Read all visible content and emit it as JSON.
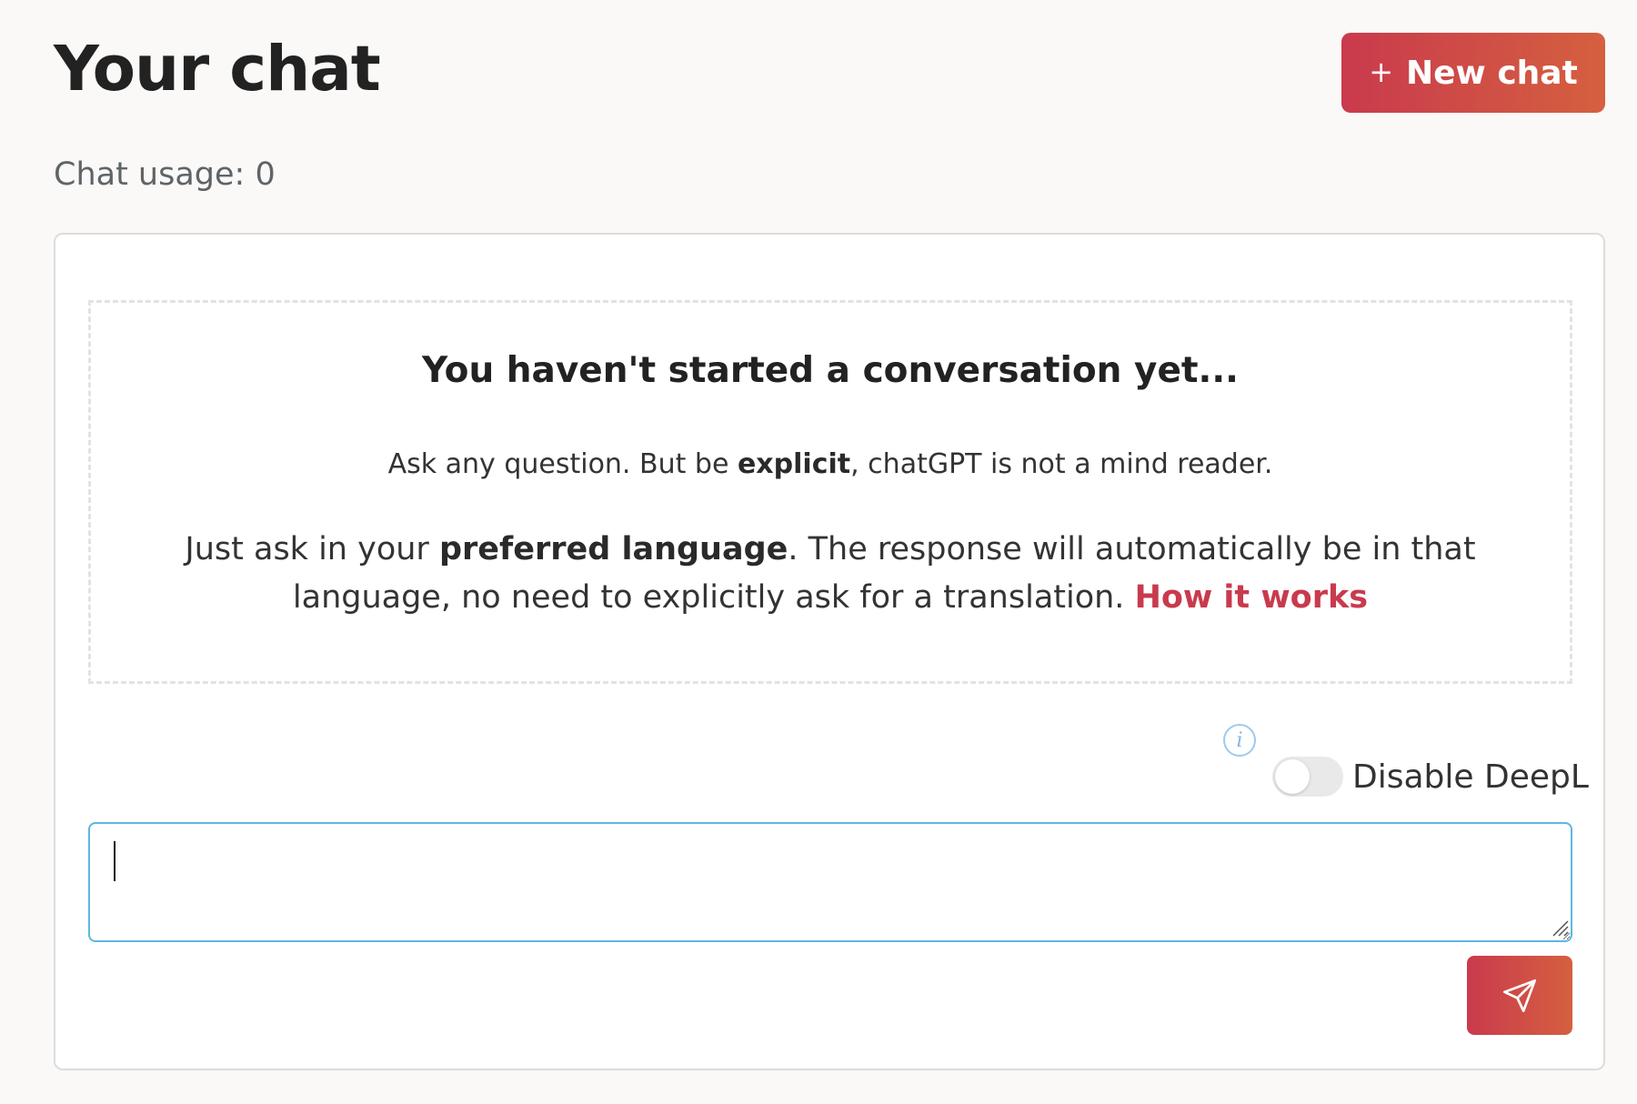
{
  "header": {
    "title": "Your chat",
    "new_chat_label": "New chat",
    "new_chat_icon": "plus-icon"
  },
  "usage": {
    "text": "Chat usage: 0"
  },
  "empty_state": {
    "title": "You haven't started a conversation yet...",
    "hint_prefix": "Ask any question. But be ",
    "hint_bold": "explicit",
    "hint_suffix": ", chatGPT is not a mind reader.",
    "lang_prefix": "Just ask in your ",
    "lang_bold": "preferred language",
    "lang_suffix": ". The response will automatically be in that language, no need to explicitly ask for a translation. ",
    "link_label": "How it works"
  },
  "controls": {
    "info_glyph": "i",
    "deepl_label": "Disable DeepL",
    "deepl_enabled": false
  },
  "composer": {
    "value": "",
    "placeholder": "",
    "send_icon": "paper-plane-icon"
  },
  "colors": {
    "accent_start": "#c93a4d",
    "accent_end": "#d5603f",
    "input_border": "#5bb8e0",
    "info_icon": "#7fb6e8"
  }
}
